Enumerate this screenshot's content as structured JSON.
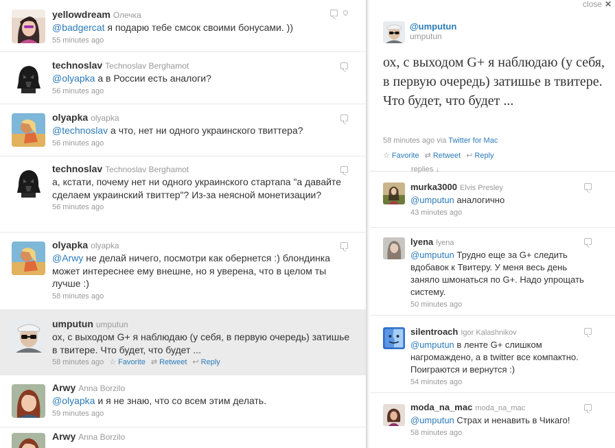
{
  "timeline": [
    {
      "screen_name": "yellowdream",
      "full_name": "Олечка",
      "mention": "@badgercat",
      "text": " я подарю тебе смсок своими бонусами. ))",
      "time": "55 minutes ago",
      "has_geo": true
    },
    {
      "screen_name": "technoslav",
      "full_name": "Technoslav Berghamot",
      "mention": "@olyapka",
      "text": " а в России есть аналоги?",
      "time": "56 minutes ago"
    },
    {
      "screen_name": "olyapka",
      "full_name": "olyapka",
      "mention": "@technoslav",
      "text": " а что, нет ни одного украинского твиттера?",
      "time": "56 minutes ago"
    },
    {
      "screen_name": "technoslav",
      "full_name": "Technoslav Berghamot",
      "mention": "",
      "text": "а, кстати, почему нет ни одного украинского стартапа \"а давайте сделаем украинский твиттер\"? Из-за неясной монетизации?",
      "time": "56 minutes ago"
    },
    {
      "screen_name": "olyapka",
      "full_name": "olyapka",
      "mention": "@Arwy",
      "text": " не делай ничего, посмотри как обернется :) блондинка может интереснее ему внешне, но я уверена, что в целом ты лучше :)",
      "time": "58 minutes ago"
    },
    {
      "screen_name": "umputun",
      "full_name": "umputun",
      "mention": "",
      "text": "ох, с выходом G+ я наблюдаю (у себя, в первую очередь) затишье в твитере. Что будет, что будет ...",
      "time": "58 minutes ago",
      "highlighted": true,
      "actions": {
        "favorite": "Favorite",
        "retweet": "Retweet",
        "reply": "Reply"
      }
    },
    {
      "screen_name": "Arwy",
      "full_name": "Anna Borzilo",
      "mention": "@olyapka",
      "text": " и я не знаю, что со всем этим делать.",
      "time": "59 minutes ago"
    },
    {
      "screen_name": "Arwy",
      "full_name": "Anna Borzilo",
      "mention": "",
      "text": "",
      "time": ""
    }
  ],
  "detail": {
    "close_label": "close",
    "close_glyph": "✕",
    "screen_name": "@umputun",
    "username": "umputun",
    "text": "ох, с выходом G+ я наблюдаю (у себя, в первую очередь) затишье в твитере. Что будет, что будет ...",
    "time": "58 minutes ago via ",
    "client": "Twitter for Mac",
    "actions": {
      "favorite": "Favorite",
      "retweet": "Retweet",
      "reply": "Reply"
    },
    "replies_label": "replies ↓"
  },
  "replies": [
    {
      "screen_name": "murka3000",
      "full_name": "Elvis Presley",
      "mention": "@umputun",
      "text": " аналогично",
      "time": "43 minutes ago"
    },
    {
      "screen_name": "lyena",
      "full_name": "lyena",
      "mention": "@umputun",
      "text": " Трудно еще за G+ следить вдобавок к Твитеру. У меня весь день заняло шмонаться по G+. Надо упрощать систему.",
      "time": "50 minutes ago"
    },
    {
      "screen_name": "silentroach",
      "full_name": "Igor Kalashnikov",
      "mention": "@umputun",
      "text": " в ленте G+ слишком нагромаждено, а в twitter все компактно. Поиграются и вернутся :)",
      "time": "54 minutes ago"
    },
    {
      "screen_name": "moda_na_mac",
      "full_name": "moda_na_mac",
      "mention": "@umputun",
      "text": " Страх и ненавить в Чикаго!",
      "time": "58 minutes ago"
    }
  ],
  "icons": {
    "reply": "reply-bubble-icon",
    "geo": "geo-pin-icon",
    "star": "☆",
    "retweet": "⇄",
    "reply_arrow": "↩"
  },
  "colors": {
    "link": "#2b7bb9",
    "highlight": "#ebebeb",
    "meta": "#999999"
  }
}
